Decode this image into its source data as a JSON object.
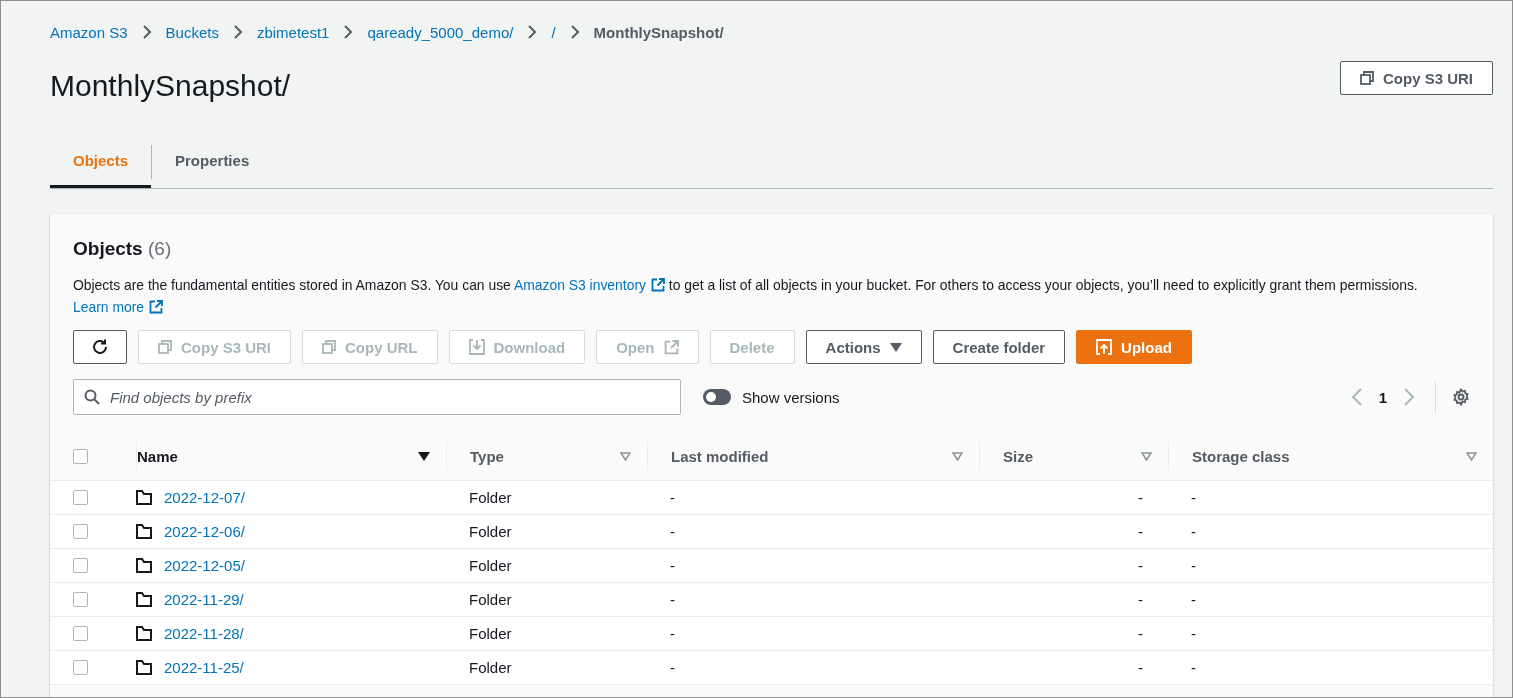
{
  "breadcrumbs": [
    {
      "label": "Amazon S3",
      "current": false
    },
    {
      "label": "Buckets",
      "current": false
    },
    {
      "label": "zbimetest1",
      "current": false
    },
    {
      "label": "qaready_5000_demo/",
      "current": false
    },
    {
      "label": "/",
      "current": false
    },
    {
      "label": "MonthlySnapshot/",
      "current": true
    }
  ],
  "title": "MonthlySnapshot/",
  "copy_uri_button": "Copy S3 URI",
  "tabs": [
    {
      "label": "Objects",
      "selected": true
    },
    {
      "label": "Properties",
      "selected": false
    }
  ],
  "objects_panel": {
    "heading": "Objects",
    "count": "(6)",
    "description": [
      {
        "kind": "text",
        "text": "Objects are the fundamental entities stored in Amazon S3. You can use "
      },
      {
        "kind": "link",
        "text": "Amazon S3 inventory"
      },
      {
        "kind": "text",
        "text": " to get a list of all objects in your bucket. For others to access your objects, you’ll need to explicitly grant them permissions. "
      },
      {
        "kind": "link",
        "text": "Learn more"
      }
    ],
    "buttons": [
      {
        "label": "Copy S3 URI",
        "kind": "copy",
        "disabled": true
      },
      {
        "label": "Copy URL",
        "kind": "copy",
        "disabled": true
      },
      {
        "label": "Download",
        "kind": "download",
        "disabled": true
      },
      {
        "label": "Open",
        "kind": "external",
        "disabled": true
      },
      {
        "label": "Delete",
        "kind": "plain",
        "disabled": true
      },
      {
        "label": "Actions",
        "kind": "dropdown",
        "disabled": false
      },
      {
        "label": "Create folder",
        "kind": "plain",
        "disabled": false
      },
      {
        "label": "Upload",
        "kind": "primary",
        "disabled": false
      }
    ],
    "search": {
      "placeholder": "Find objects by prefix"
    },
    "show_versions": {
      "label": "Show versions",
      "on": false
    },
    "page": "1",
    "table": {
      "all_selected": false,
      "columns": [
        {
          "label": "Name",
          "sorted": true
        },
        {
          "label": "Type",
          "sorted": false
        },
        {
          "label": "Last modified",
          "sorted": false
        },
        {
          "label": "Size",
          "sorted": false
        },
        {
          "label": "Storage class",
          "sorted": false
        }
      ],
      "rows": [
        {
          "name": "2022-12-07/",
          "type": "Folder",
          "last_modified": "-",
          "size": "-",
          "storage_class": "-",
          "selected": false
        },
        {
          "name": "2022-12-06/",
          "type": "Folder",
          "last_modified": "-",
          "size": "-",
          "storage_class": "-",
          "selected": false
        },
        {
          "name": "2022-12-05/",
          "type": "Folder",
          "last_modified": "-",
          "size": "-",
          "storage_class": "-",
          "selected": false
        },
        {
          "name": "2022-11-29/",
          "type": "Folder",
          "last_modified": "-",
          "size": "-",
          "storage_class": "-",
          "selected": false
        },
        {
          "name": "2022-11-28/",
          "type": "Folder",
          "last_modified": "-",
          "size": "-",
          "storage_class": "-",
          "selected": false
        },
        {
          "name": "2022-11-25/",
          "type": "Folder",
          "last_modified": "-",
          "size": "-",
          "storage_class": "-",
          "selected": false
        }
      ]
    }
  }
}
